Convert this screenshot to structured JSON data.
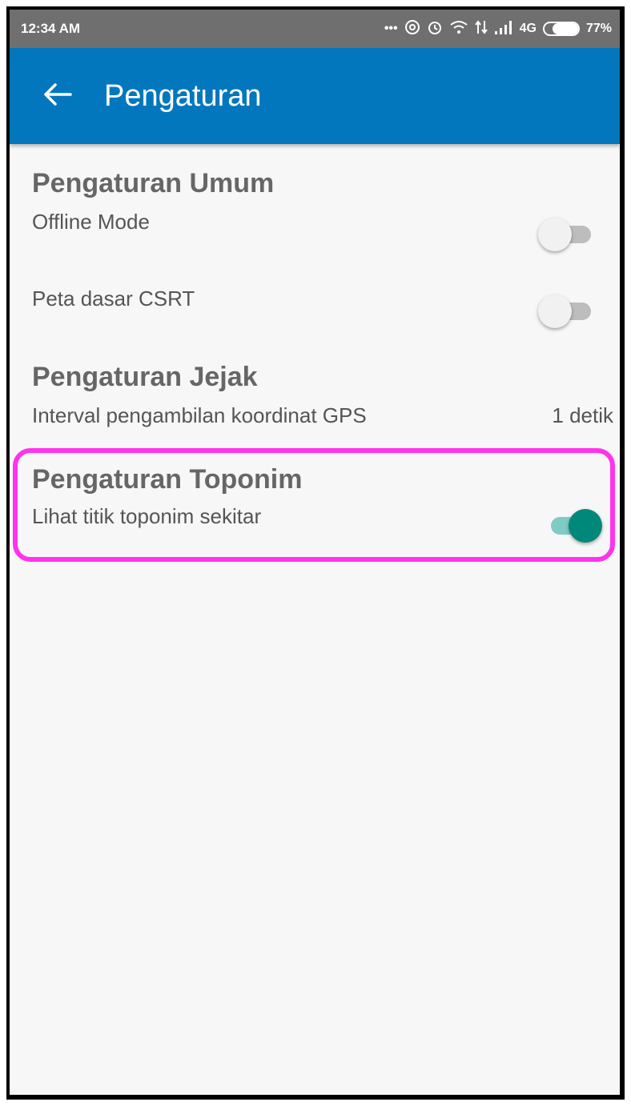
{
  "status_bar": {
    "time": "12:34 AM",
    "icons": [
      "more-dots-icon",
      "hotspot-icon",
      "alarm-icon",
      "wifi-icon",
      "data-arrows-icon",
      "signal-icon"
    ],
    "network": "4G",
    "battery": "77%",
    "battery_level": 0.77
  },
  "app_bar": {
    "title": "Pengaturan",
    "back_icon": "arrow-left-icon",
    "color": "#0277bd"
  },
  "sections": {
    "umum": {
      "title": "Pengaturan Umum",
      "offline_mode_label": "Offline Mode",
      "offline_mode_on": false,
      "peta_dasar_label": "Peta dasar CSRT",
      "peta_dasar_on": false
    },
    "jejak": {
      "title": "Pengaturan Jejak",
      "interval_label": "Interval pengambilan koordinat GPS",
      "interval_value": "1 detik"
    },
    "toponim": {
      "title": "Pengaturan Toponim",
      "lihat_label": "Lihat titik toponim sekitar",
      "lihat_on": true
    }
  },
  "colors": {
    "switch_on_thumb": "#00897b",
    "switch_on_track": "#80cbc4",
    "highlight": "#ff33ee"
  }
}
